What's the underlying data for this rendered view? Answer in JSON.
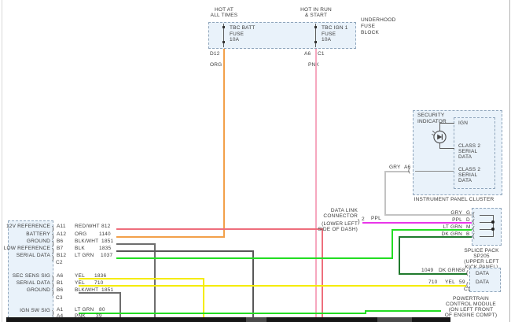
{
  "colors": {
    "org": "#f2a04a",
    "pnk": "#f6a8bf",
    "red_wht": "#ee6e7c",
    "blk_wht": "#6e6e6e",
    "blk": "#585858",
    "lt_grn": "#23dd23",
    "dk_grn": "#207a2d",
    "yel": "#f5ec00",
    "ppl": "#e935e9",
    "gry": "#c3c3c3",
    "bar": "#161616",
    "bar_segment": "#4b4b4b"
  },
  "fuse_block": {
    "caption": [
      "UNDERHOOD",
      "FUSE",
      "BLOCK"
    ],
    "hot_left": [
      "HOT AT",
      "ALL TIMES"
    ],
    "hot_right": [
      "HOT IN RUN",
      "& START"
    ],
    "fuse_left": {
      "name": [
        "TBC BATT",
        "FUSE",
        "10A"
      ],
      "terminal": "D12",
      "wire": "ORG"
    },
    "fuse_right": {
      "name": [
        "TBC IGN 1",
        "FUSE",
        "10A"
      ],
      "terminal": "A6",
      "connector": "C1",
      "wire": "PNK"
    }
  },
  "cluster": {
    "title": [
      "SECURITY",
      "INDICATOR"
    ],
    "ign_label": "IGN",
    "class2_a": [
      "CLASS 2",
      "SERIAL",
      "DATA"
    ],
    "class2_b": [
      "CLASS 2",
      "SERIAL",
      "DATA"
    ],
    "wire": "GRY",
    "terminal": "A6",
    "caption": "INSTRUMENT PANEL CLUSTER"
  },
  "dlc": {
    "caption": [
      "DATA LINK",
      "CONNECTOR",
      "(LOWER LEFT",
      "SIDE OF DASH)"
    ],
    "terminal": "2",
    "wire": "PPL"
  },
  "splice": {
    "rows": [
      {
        "wire": "GRY",
        "terminal": "G"
      },
      {
        "wire": "PPL",
        "terminal": "D"
      },
      {
        "wire": "LT GRN",
        "terminal": "M"
      },
      {
        "wire": "DK GRN",
        "terminal": "B"
      }
    ],
    "caption": [
      "SPLICE PACK",
      "SP205",
      "(UPPER LEFT",
      "KICK PANEL)"
    ]
  },
  "pcm": {
    "row_a": {
      "circuit": "1049",
      "wire": "DK GRN",
      "terminal": "58",
      "label": "DATA"
    },
    "row_b": {
      "circuit": "710",
      "wire": "YEL",
      "terminal": "59",
      "label": "DATA"
    },
    "connector": "C1",
    "caption": [
      "POWERTRAIN",
      "CONTROL MODULE",
      "(ON LEFT FRONT",
      "OF ENGINE COMPT)"
    ]
  },
  "module": {
    "group1": [
      {
        "label": "12V REFERENCE",
        "terminal": "A11",
        "wire": "RED/WHT",
        "circuit": "812"
      },
      {
        "label": "BATTERY",
        "terminal": "A12",
        "wire": "ORG",
        "circuit": "1140"
      },
      {
        "label": "GROUND",
        "terminal": "B6",
        "wire": "BLK/WHT",
        "circuit": "1851"
      },
      {
        "label": "LOW REFERENCE",
        "terminal": "B7",
        "wire": "BLK",
        "circuit": "1835"
      },
      {
        "label": "SERIAL DATA",
        "terminal": "B12",
        "wire": "LT GRN",
        "circuit": "1037"
      }
    ],
    "connector1": "C2",
    "group2": [
      {
        "label": "SEC SENS SIG",
        "terminal": "A6",
        "wire": "YEL",
        "circuit": "1836"
      },
      {
        "label": "SERIAL DATA",
        "terminal": "B1",
        "wire": "YEL",
        "circuit": "710"
      },
      {
        "label": "GROUND",
        "terminal": "B6",
        "wire": "BLK/WHT",
        "circuit": "1851"
      }
    ],
    "connector2": "C3",
    "group3": [
      {
        "label": "IGN SW SIG",
        "terminal": "A1",
        "wire": "LT GRN",
        "circuit": "80"
      },
      {
        "label": "",
        "terminal": "A4",
        "wire": "PNK",
        "circuit": "39"
      }
    ]
  }
}
